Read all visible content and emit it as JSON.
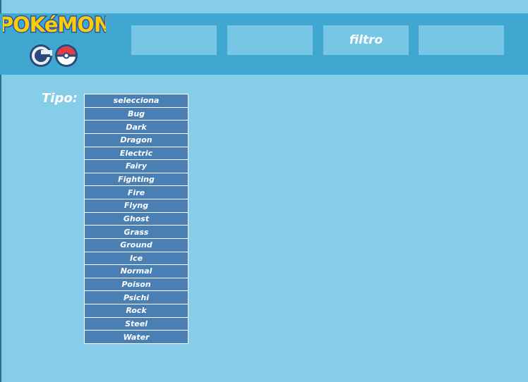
{
  "logo": {
    "line1": "POKéMON",
    "line2": "GO",
    "tm": "™"
  },
  "nav": {
    "tabs": [
      "",
      "",
      "filtro",
      ""
    ]
  },
  "filter": {
    "label": "Tipo:",
    "options": [
      "selecciona",
      "Bug",
      "Dark",
      "Dragon",
      "Electric",
      "Fairy",
      "Fighting",
      "Fire",
      "Flyng",
      "Ghost",
      "Grass",
      "Ground",
      "Ice",
      "Normal",
      "Poison",
      "Psichi",
      "Rock",
      "Steel",
      "Water"
    ]
  },
  "colors": {
    "background": "#86cde9",
    "header": "#40a8d0",
    "tab": "#77c6e6",
    "list_item": "#4a7fb4",
    "text": "#ffffff"
  }
}
